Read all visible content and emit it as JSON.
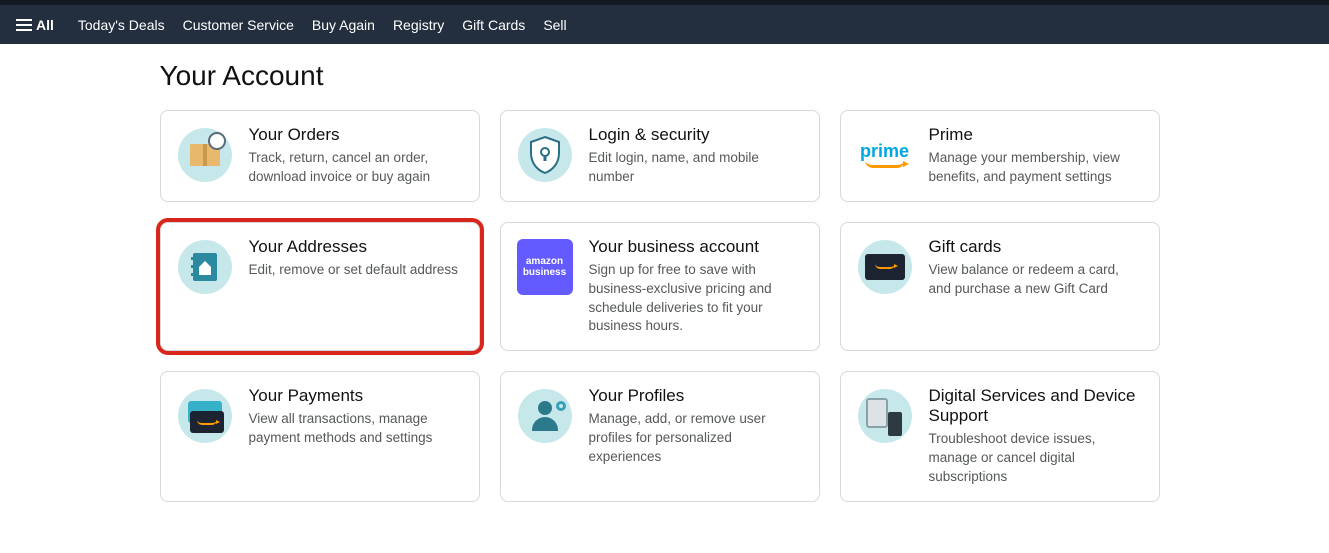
{
  "nav": {
    "all": "All",
    "links": [
      "Today's Deals",
      "Customer Service",
      "Buy Again",
      "Registry",
      "Gift Cards",
      "Sell"
    ]
  },
  "page_title": "Your Account",
  "cards": [
    {
      "title": "Your Orders",
      "desc": "Track, return, cancel an order, download invoice or buy again"
    },
    {
      "title": "Login & security",
      "desc": "Edit login, name, and mobile number"
    },
    {
      "title": "Prime",
      "desc": "Manage your membership, view benefits, and payment settings",
      "prime_label": "prime"
    },
    {
      "title": "Your Addresses",
      "desc": "Edit, remove or set default address"
    },
    {
      "title": "Your business account",
      "desc": "Sign up for free to save with business-exclusive pricing and schedule deliveries to fit your business hours.",
      "biz_line1": "amazon",
      "biz_line2": "business"
    },
    {
      "title": "Gift cards",
      "desc": "View balance or redeem a card, and purchase a new Gift Card"
    },
    {
      "title": "Your Payments",
      "desc": "View all transactions, manage payment methods and settings"
    },
    {
      "title": "Your Profiles",
      "desc": "Manage, add, or remove user profiles for personalized experiences"
    },
    {
      "title": "Digital Services and Device Support",
      "desc": "Troubleshoot device issues, manage or cancel digital subscriptions"
    }
  ]
}
